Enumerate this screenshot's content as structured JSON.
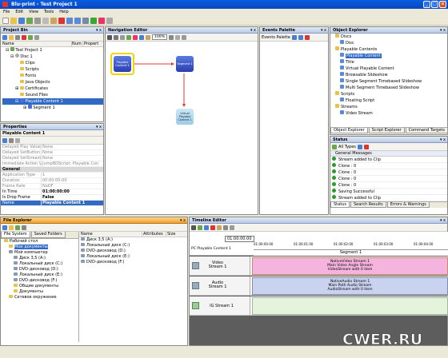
{
  "window": {
    "title": "Blu-print - Test Project 1"
  },
  "menu": [
    "File",
    "Edit",
    "View",
    "Tools",
    "Help"
  ],
  "project_bin": {
    "title": "Project Bin",
    "columns": [
      "Name",
      "Num",
      "Propert"
    ],
    "items": [
      "Test Project 1",
      "Disc 1",
      "Clips",
      "Scripts",
      "Fonts",
      "Java Objects",
      "Certificates",
      "Sound Files",
      "Playable Content 1",
      "Segment 1"
    ],
    "selected": "Playable Content 1"
  },
  "properties": {
    "title": "Properties",
    "object": "Playable Content 1",
    "rows": [
      {
        "k": "Delayed Play Value",
        "v": "None"
      },
      {
        "k": "Delayed SetButton Val",
        "v": "None"
      },
      {
        "k": "Delayed SetStream Val",
        "v": "None"
      },
      {
        "k": "Immediate Action Val",
        "v": "JumpBDScript: Playable Con"
      },
      {
        "k": "General",
        "v": ""
      },
      {
        "k": "Application Type",
        "v": "1"
      },
      {
        "k": "Duration",
        "v": "00:00:05:00"
      },
      {
        "k": "Frame Rate",
        "v": "NoDF"
      },
      {
        "k": "In Time",
        "v": "01:00:00:00"
      },
      {
        "k": "Is Drop Frame",
        "v": "False"
      },
      {
        "k": "Name",
        "v": "Playable Content 1"
      }
    ]
  },
  "navigation_editor": {
    "title": "Navigation Editor",
    "zoom": "100%",
    "nodes": [
      {
        "label": "Playable Content 1"
      },
      {
        "label": "Segment 1"
      },
      {
        "label": "Virtual Playable Content 1"
      }
    ]
  },
  "events_palette": {
    "title": "Events Palette",
    "subtitle": "Events Palette"
  },
  "object_explorer": {
    "title": "Object Explorer",
    "items": [
      "Discs",
      "Disc",
      "Playable Contents",
      "Playable Content",
      "Title",
      "Virtual Playable Content",
      "Browsable Slideshow",
      "Single Segment Timebased Slideshow",
      "Multi Segment Timebased Slideshow",
      "Scripts",
      "Floating Script",
      "Streams",
      "Video Stream"
    ],
    "selected": "Playable Content",
    "tabs": [
      "Object Explorer",
      "Script Explorer",
      "Command Targets"
    ]
  },
  "status": {
    "title": "Status",
    "filter": "All Types",
    "group": "General Messages",
    "messages": [
      "Stream added to Clip",
      "Clone : 0",
      "Clone : 0",
      "Clone : 0",
      "Clone : 0",
      "Saving Successful",
      "Stream added to Clip"
    ],
    "tabs": [
      "Status",
      "Search Results",
      "Errors & Warnings"
    ]
  },
  "file_explorer": {
    "title": "File Explorer",
    "tabs": [
      "File System",
      "Saved Folders"
    ],
    "tree": [
      "Рабочий стол",
      "Мои документы",
      "Мой компьютер",
      "Диск 3,5 (A:)",
      "Локальный диск (C:)",
      "DVD-дисковод (D:)",
      "Локальный диск (E:)",
      "DVD-дисковод (F:)",
      "Общие документы",
      "Документы",
      "Сетевое окружение"
    ],
    "columns": [
      "Name",
      "Attributes",
      "Size"
    ],
    "files": [
      "Диск 3,5 (A:)",
      "Локальный диск (C:)",
      "DVD-дисковод (D:)",
      "Локальный диск (E:)",
      "DVD-дисковод (F:)"
    ]
  },
  "timeline_editor": {
    "title": "Timeline Editor",
    "timecode": "01:00:00:00",
    "content_label": "PC Playable Content 1",
    "ticks": [
      "01:00:00:00",
      "01:00:01:00",
      "01:00:02:00",
      "01:00:03:00",
      "01:00:04:00"
    ],
    "segment": "Segment 1",
    "tracks": [
      {
        "name": "Video Stream 1",
        "lines": [
          "NativeVideo Stream 1",
          "Main Video Angle Stream",
          "VideoStream with 0 item"
        ]
      },
      {
        "name": "Audio Stream 1",
        "lines": [
          "NativeAudio Stream 1",
          "Main Path Audio Stream",
          "AudioStream with 0 item"
        ]
      },
      {
        "name": "IG Stream 1",
        "lines": []
      }
    ]
  },
  "watermark": "CWER.RU"
}
